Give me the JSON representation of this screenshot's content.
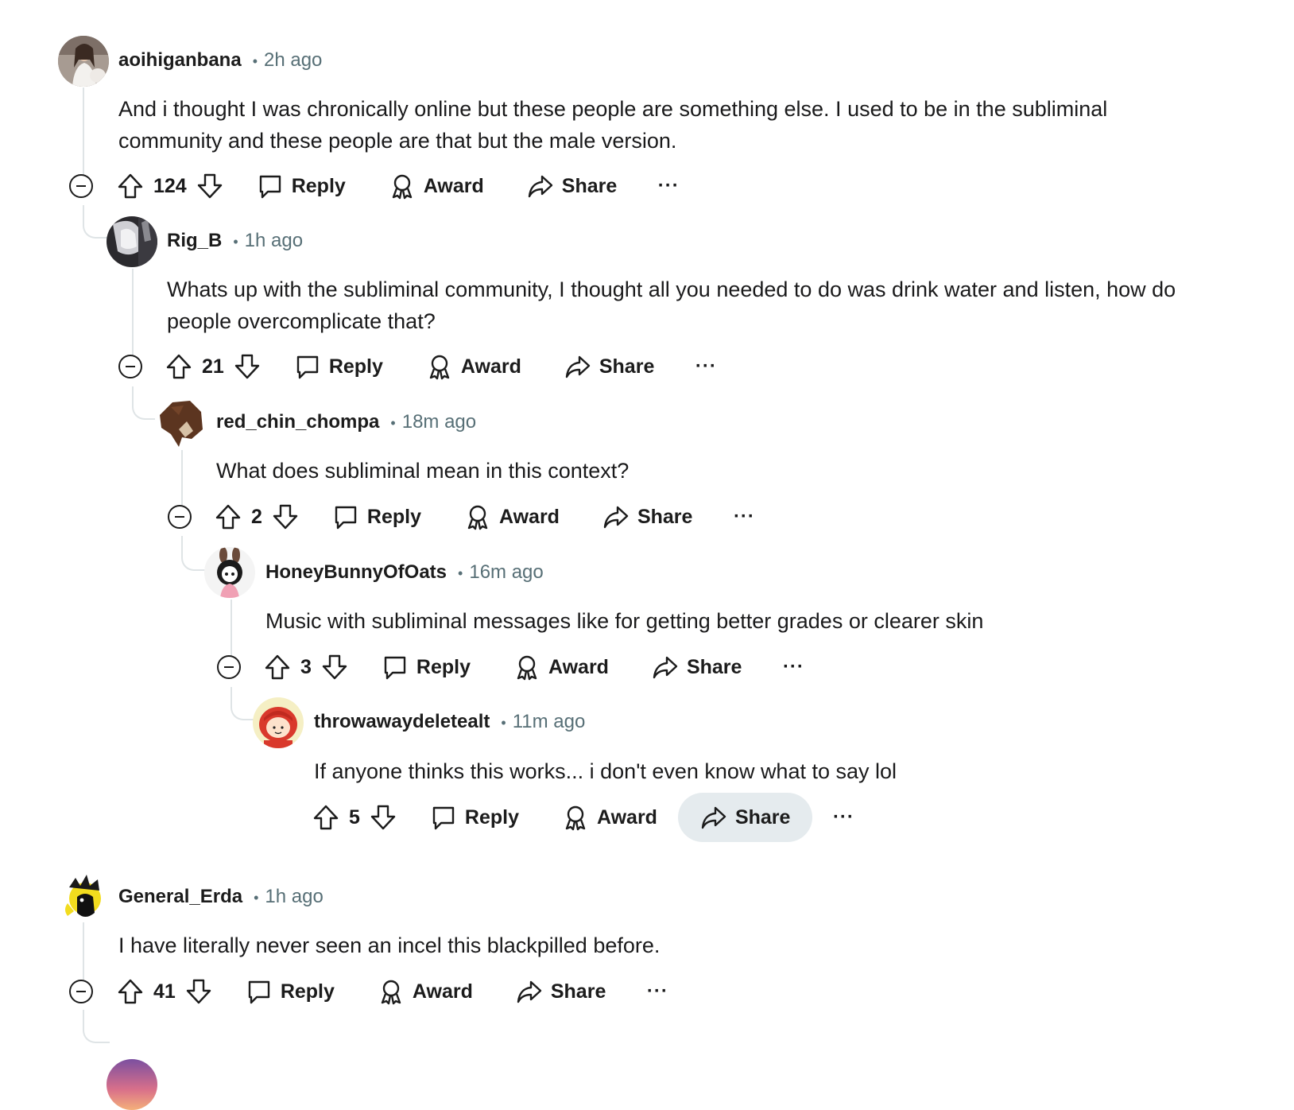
{
  "comments": [
    {
      "author": "aoihiganbana",
      "time": "2h ago",
      "body": "And i thought I was chronically online but these people are something else. I used to be in the subliminal community and these people are that but the male version.",
      "score": "124",
      "reply": "Reply",
      "award": "Award",
      "share": "Share",
      "more": "···",
      "avatar": "woman-photo-avatar"
    },
    {
      "author": "Rig_B",
      "time": "1h ago",
      "body": "Whats up with the subliminal community, I thought all you needed to do was drink water and listen, how do people overcomplicate that?",
      "score": "21",
      "reply": "Reply",
      "award": "Award",
      "share": "Share",
      "more": "···",
      "avatar": "photo-avatar"
    },
    {
      "author": "red_chin_chompa",
      "time": "18m ago",
      "body": "What does subliminal mean in this context?",
      "score": "2",
      "reply": "Reply",
      "award": "Award",
      "share": "Share",
      "more": "···",
      "avatar": "brown-creature-avatar"
    },
    {
      "author": "HoneyBunnyOfOats",
      "time": "16m ago",
      "body": "Music with subliminal messages like for getting better grades or clearer skin",
      "score": "3",
      "reply": "Reply",
      "award": "Award",
      "share": "Share",
      "more": "···",
      "avatar": "bunny-girl-avatar"
    },
    {
      "author": "throwawaydeletealt",
      "time": "11m ago",
      "body": "If anyone thinks this works... i don't even know what to say lol",
      "score": "5",
      "reply": "Reply",
      "award": "Award",
      "share": "Share",
      "more": "···",
      "avatar": "red-hair-cartoon-avatar"
    },
    {
      "author": "General_Erda",
      "time": "1h ago",
      "body": "I have literally never seen an incel this blackpilled before.",
      "score": "41",
      "reply": "Reply",
      "award": "Award",
      "share": "Share",
      "more": "···",
      "avatar": "yellow-black-avatar"
    }
  ],
  "colors": {
    "meta": "#576f76",
    "thread": "#dfe4e6",
    "active_button": "#e5ebee"
  }
}
